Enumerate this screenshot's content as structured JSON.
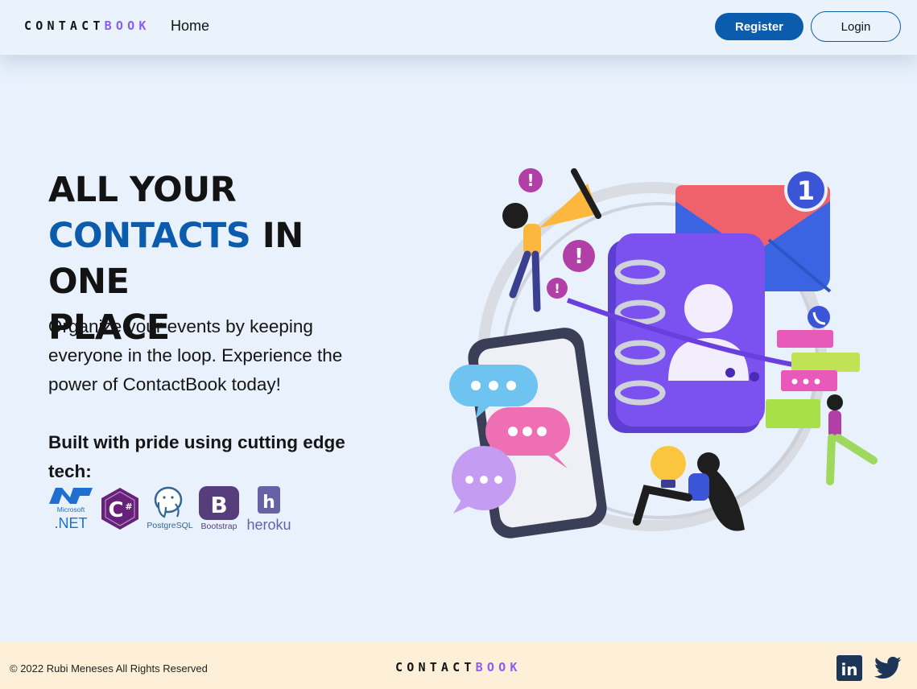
{
  "brand": {
    "part1": "CONTACT",
    "part2": "BOOK",
    "dark_color": "#131313",
    "accent_color": "#8b5cf6"
  },
  "nav": {
    "home_label": "Home",
    "register_label": "Register",
    "login_label": "Login",
    "register_bg": "#0b5cad"
  },
  "hero": {
    "title_line1": "ALL YOUR",
    "title_accent": "CONTACTS",
    "title_after_accent": " IN ONE",
    "title_line3": "PLACE",
    "description": "Organize your events by keeping everyone in the loop. Experience the power of ContactBook today!",
    "tech_heading": "Built with pride using cutting edge tech:",
    "accent_color": "#0b5cad"
  },
  "tech_stack": [
    {
      "icon": "dotnet-icon",
      "label_top": "Microsoft",
      "label_bottom": ".NET"
    },
    {
      "icon": "csharp-icon",
      "label": "C#"
    },
    {
      "icon": "postgresql-icon",
      "label": "PostgreSQL"
    },
    {
      "icon": "bootstrap-icon",
      "glyph": "B",
      "label": "Bootstrap"
    },
    {
      "icon": "heroku-icon",
      "glyph": "h",
      "label": "heroku"
    }
  ],
  "illustration": {
    "badge_count": "1"
  },
  "footer": {
    "copyright": "© 2022 Rubi Meneses All Rights Reserved",
    "social": [
      "linkedin-icon",
      "twitter-icon"
    ],
    "linkedin_glyph": "in"
  },
  "colors": {
    "page_bg": "#e8f1fc",
    "footer_bg": "#fef0d8",
    "purple": "#7b4ff0"
  }
}
